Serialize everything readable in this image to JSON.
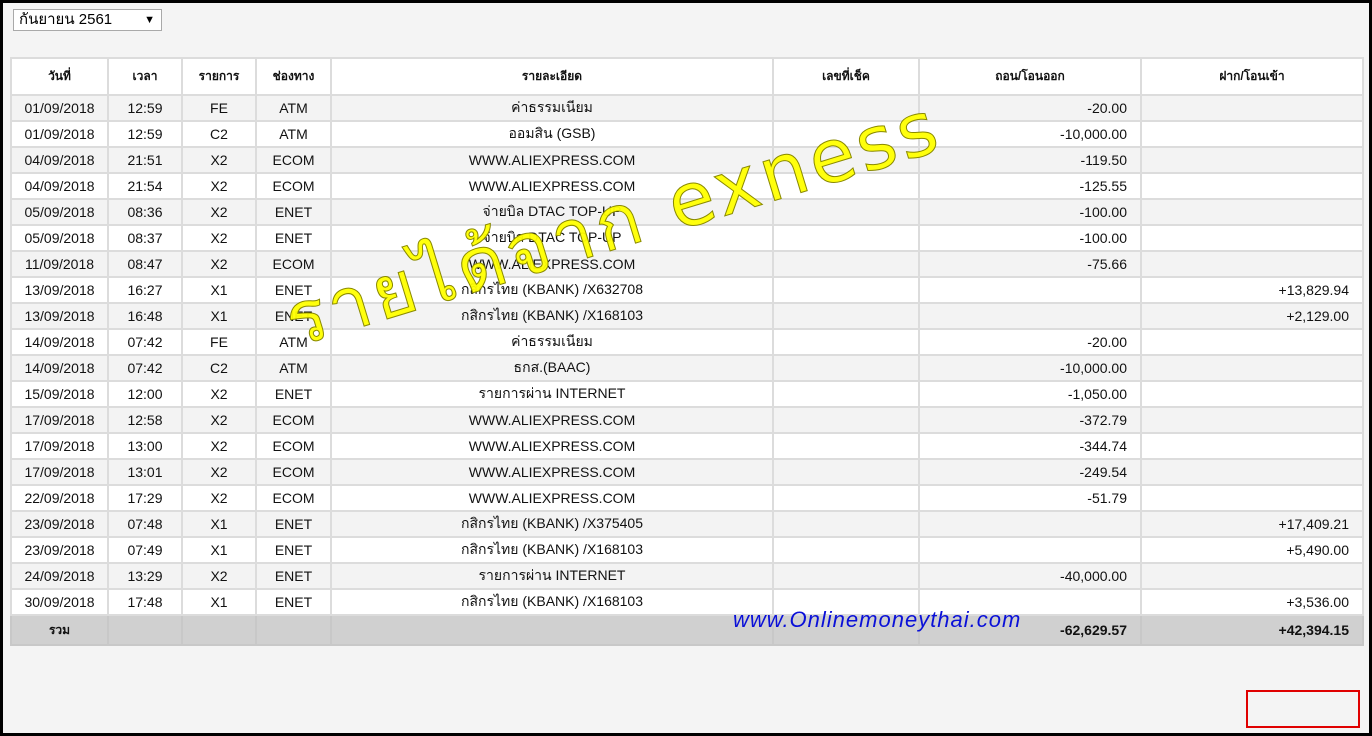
{
  "month_select": {
    "value": "กันยายน 2561",
    "caret": "▼"
  },
  "table": {
    "headers": [
      "วันที่",
      "เวลา",
      "รายการ",
      "ช่องทาง",
      "รายละเอียด",
      "เลขที่เช็ค",
      "ถอน/โอนออก",
      "ฝาก/โอนเข้า"
    ],
    "rows": [
      {
        "date": "01/09/2018",
        "time": "12:59",
        "code": "FE",
        "channel": "ATM",
        "detail": "ค่าธรรมเนียม",
        "cheque": "",
        "withdraw": "-20.00",
        "deposit": ""
      },
      {
        "date": "01/09/2018",
        "time": "12:59",
        "code": "C2",
        "channel": "ATM",
        "detail": "ออมสิน (GSB)",
        "cheque": "",
        "withdraw": "-10,000.00",
        "deposit": ""
      },
      {
        "date": "04/09/2018",
        "time": "21:51",
        "code": "X2",
        "channel": "ECOM",
        "detail": "WWW.ALIEXPRESS.COM",
        "cheque": "",
        "withdraw": "-119.50",
        "deposit": ""
      },
      {
        "date": "04/09/2018",
        "time": "21:54",
        "code": "X2",
        "channel": "ECOM",
        "detail": "WWW.ALIEXPRESS.COM",
        "cheque": "",
        "withdraw": "-125.55",
        "deposit": ""
      },
      {
        "date": "05/09/2018",
        "time": "08:36",
        "code": "X2",
        "channel": "ENET",
        "detail": "จ่ายบิล DTAC TOP-UP",
        "cheque": "",
        "withdraw": "-100.00",
        "deposit": ""
      },
      {
        "date": "05/09/2018",
        "time": "08:37",
        "code": "X2",
        "channel": "ENET",
        "detail": "จ่ายบิล DTAC TOP-UP",
        "cheque": "",
        "withdraw": "-100.00",
        "deposit": ""
      },
      {
        "date": "11/09/2018",
        "time": "08:47",
        "code": "X2",
        "channel": "ECOM",
        "detail": "WWW.ALIEXPRESS.COM",
        "cheque": "",
        "withdraw": "-75.66",
        "deposit": ""
      },
      {
        "date": "13/09/2018",
        "time": "16:27",
        "code": "X1",
        "channel": "ENET",
        "detail": "กสิกรไทย (KBANK) /X632708",
        "cheque": "",
        "withdraw": "",
        "deposit": "+13,829.94"
      },
      {
        "date": "13/09/2018",
        "time": "16:48",
        "code": "X1",
        "channel": "ENET",
        "detail": "กสิกรไทย (KBANK) /X168103",
        "cheque": "",
        "withdraw": "",
        "deposit": "+2,129.00"
      },
      {
        "date": "14/09/2018",
        "time": "07:42",
        "code": "FE",
        "channel": "ATM",
        "detail": "ค่าธรรมเนียม",
        "cheque": "",
        "withdraw": "-20.00",
        "deposit": ""
      },
      {
        "date": "14/09/2018",
        "time": "07:42",
        "code": "C2",
        "channel": "ATM",
        "detail": "ธกส.(BAAC)",
        "cheque": "",
        "withdraw": "-10,000.00",
        "deposit": ""
      },
      {
        "date": "15/09/2018",
        "time": "12:00",
        "code": "X2",
        "channel": "ENET",
        "detail": "รายการผ่าน INTERNET",
        "cheque": "",
        "withdraw": "-1,050.00",
        "deposit": ""
      },
      {
        "date": "17/09/2018",
        "time": "12:58",
        "code": "X2",
        "channel": "ECOM",
        "detail": "WWW.ALIEXPRESS.COM",
        "cheque": "",
        "withdraw": "-372.79",
        "deposit": ""
      },
      {
        "date": "17/09/2018",
        "time": "13:00",
        "code": "X2",
        "channel": "ECOM",
        "detail": "WWW.ALIEXPRESS.COM",
        "cheque": "",
        "withdraw": "-344.74",
        "deposit": ""
      },
      {
        "date": "17/09/2018",
        "time": "13:01",
        "code": "X2",
        "channel": "ECOM",
        "detail": "WWW.ALIEXPRESS.COM",
        "cheque": "",
        "withdraw": "-249.54",
        "deposit": ""
      },
      {
        "date": "22/09/2018",
        "time": "17:29",
        "code": "X2",
        "channel": "ECOM",
        "detail": "WWW.ALIEXPRESS.COM",
        "cheque": "",
        "withdraw": "-51.79",
        "deposit": ""
      },
      {
        "date": "23/09/2018",
        "time": "07:48",
        "code": "X1",
        "channel": "ENET",
        "detail": "กสิกรไทย (KBANK) /X375405",
        "cheque": "",
        "withdraw": "",
        "deposit": "+17,409.21"
      },
      {
        "date": "23/09/2018",
        "time": "07:49",
        "code": "X1",
        "channel": "ENET",
        "detail": "กสิกรไทย (KBANK) /X168103",
        "cheque": "",
        "withdraw": "",
        "deposit": "+5,490.00"
      },
      {
        "date": "24/09/2018",
        "time": "13:29",
        "code": "X2",
        "channel": "ENET",
        "detail": "รายการผ่าน INTERNET",
        "cheque": "",
        "withdraw": "-40,000.00",
        "deposit": ""
      },
      {
        "date": "30/09/2018",
        "time": "17:48",
        "code": "X1",
        "channel": "ENET",
        "detail": "กสิกรไทย (KBANK) /X168103",
        "cheque": "",
        "withdraw": "",
        "deposit": "+3,536.00"
      }
    ],
    "total": {
      "label": "รวม",
      "withdraw": "-62,629.57",
      "deposit": "+42,394.15"
    }
  },
  "overlays": {
    "watermark_text": "รายได้จาก exness",
    "site_url": "www.Onlinemoneythai.com"
  },
  "colors": {
    "watermark": "#ffff00",
    "site_url": "#0a10d8",
    "highlight_border": "#e00000",
    "total_row_bg": "#d0d0d0"
  }
}
